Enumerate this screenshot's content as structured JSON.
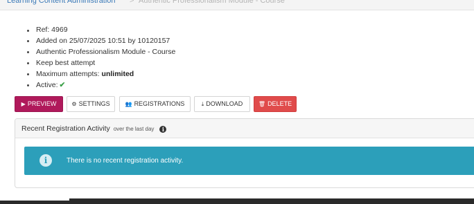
{
  "breadcrumb": {
    "link": "Learning Content Administration",
    "separator": ">",
    "current": "Authentic Professionalism Module - Course"
  },
  "details": {
    "ref": "Ref: 4969",
    "added": "Added on 25/07/2025 10:51 by 10120157",
    "course": "Authentic Professionalism Module - Course",
    "keep": "Keep best attempt",
    "max_attempts_label": "Maximum attempts: ",
    "max_attempts_value": "unlimited",
    "active_label": "Active:",
    "active_icon": "checkmark-icon"
  },
  "actions": {
    "preview": "PREVIEW",
    "settings": "SETTINGS",
    "registrations": "REGISTRATIONS",
    "download": "DOWNLOAD",
    "delete": "DELETE"
  },
  "panel": {
    "title": "Recent Registration Activity",
    "subtitle": "over the last day",
    "alert_text": "There is no recent registration activity."
  },
  "colors": {
    "preview_button": "#b0195b",
    "delete_button": "#e04b4b",
    "info_alert": "#2c9fba",
    "active_check": "#3aa047",
    "breadcrumb_link": "#3b7ab8"
  }
}
